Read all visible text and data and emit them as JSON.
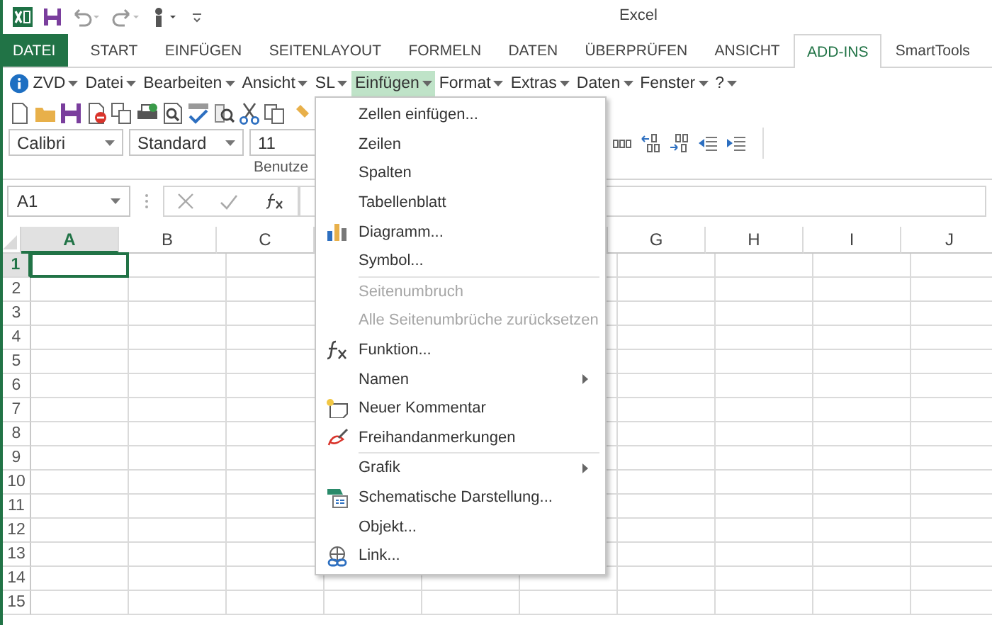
{
  "window": {
    "title": "Excel"
  },
  "ribbon_tabs": [
    {
      "label": "DATEI",
      "selected": false,
      "kind": "file"
    },
    {
      "label": "START",
      "selected": false,
      "kind": "tab"
    },
    {
      "label": "EINFÜGEN",
      "selected": false,
      "kind": "tab"
    },
    {
      "label": "SEITENLAYOUT",
      "selected": false,
      "kind": "tab"
    },
    {
      "label": "FORMELN",
      "selected": false,
      "kind": "tab"
    },
    {
      "label": "DATEN",
      "selected": false,
      "kind": "tab"
    },
    {
      "label": "ÜBERPRÜFEN",
      "selected": false,
      "kind": "tab"
    },
    {
      "label": "ANSICHT",
      "selected": false,
      "kind": "tab"
    },
    {
      "label": "ADD-INS",
      "selected": true,
      "kind": "tab"
    },
    {
      "label": "SmartTools",
      "selected": false,
      "kind": "tab"
    }
  ],
  "menu_bar": [
    {
      "label": "ZVD",
      "selected": false
    },
    {
      "label": "Datei",
      "selected": false
    },
    {
      "label": "Bearbeiten",
      "selected": false
    },
    {
      "label": "Ansicht",
      "selected": false
    },
    {
      "label": "SL",
      "selected": false
    },
    {
      "label": "Einfügen",
      "selected": true
    },
    {
      "label": "Format",
      "selected": false
    },
    {
      "label": "Extras",
      "selected": false
    },
    {
      "label": "Daten",
      "selected": false
    },
    {
      "label": "Fenster",
      "selected": false
    },
    {
      "label": "?",
      "selected": false
    }
  ],
  "font_row": {
    "font": "Calibri",
    "style": "Standard",
    "size": "11"
  },
  "group_label": "Benutze",
  "formula_bar": {
    "name_box": "A1"
  },
  "sheet": {
    "columns": [
      {
        "label": "A",
        "selected": true
      },
      {
        "label": "B",
        "selected": false
      },
      {
        "label": "C",
        "selected": false
      },
      {
        "label": "G",
        "selected": false
      },
      {
        "label": "H",
        "selected": false
      },
      {
        "label": "I",
        "selected": false
      },
      {
        "label": "J",
        "selected": false
      }
    ],
    "rows": [
      {
        "label": "1",
        "selected": true
      },
      {
        "label": "2",
        "selected": false
      },
      {
        "label": "3",
        "selected": false
      },
      {
        "label": "4",
        "selected": false
      },
      {
        "label": "5",
        "selected": false
      },
      {
        "label": "6",
        "selected": false
      },
      {
        "label": "7",
        "selected": false
      },
      {
        "label": "8",
        "selected": false
      },
      {
        "label": "9",
        "selected": false
      },
      {
        "label": "10",
        "selected": false
      },
      {
        "label": "11",
        "selected": false
      },
      {
        "label": "12",
        "selected": false
      },
      {
        "label": "13",
        "selected": false
      },
      {
        "label": "14",
        "selected": false
      },
      {
        "label": "15",
        "selected": false
      }
    ]
  },
  "dropdown_menu": [
    {
      "label": "Zellen einfügen...",
      "kind": "plain",
      "disabled": false,
      "submenu": false,
      "divider_above": false
    },
    {
      "label": "Zeilen",
      "kind": "plain",
      "disabled": false,
      "submenu": false,
      "divider_above": false
    },
    {
      "label": "Spalten",
      "kind": "plain",
      "disabled": false,
      "submenu": false,
      "divider_above": false
    },
    {
      "label": "Tabellenblatt",
      "kind": "plain",
      "disabled": false,
      "submenu": false,
      "divider_above": false
    },
    {
      "label": "Diagramm...",
      "kind": "chart",
      "disabled": false,
      "submenu": false,
      "divider_above": false
    },
    {
      "label": "Symbol...",
      "kind": "plain",
      "disabled": false,
      "submenu": false,
      "divider_above": false
    },
    {
      "label": "Seitenumbruch",
      "kind": "plain",
      "disabled": true,
      "submenu": false,
      "divider_above": true
    },
    {
      "label": "Alle Seitenumbrüche zurücksetzen",
      "kind": "plain",
      "disabled": true,
      "submenu": false,
      "divider_above": false
    },
    {
      "label": "Funktion...",
      "kind": "function",
      "disabled": false,
      "submenu": false,
      "divider_above": false
    },
    {
      "label": "Namen",
      "kind": "plain",
      "disabled": false,
      "submenu": true,
      "divider_above": false
    },
    {
      "label": "Neuer Kommentar",
      "kind": "comment",
      "disabled": false,
      "submenu": false,
      "divider_above": false
    },
    {
      "label": "Freihandanmerkungen",
      "kind": "ink",
      "disabled": false,
      "submenu": false,
      "divider_above": false
    },
    {
      "label": "Grafik",
      "kind": "plain",
      "disabled": false,
      "submenu": true,
      "divider_above": true
    },
    {
      "label": "Schematische Darstellung...",
      "kind": "diagram",
      "disabled": false,
      "submenu": false,
      "divider_above": false
    },
    {
      "label": "Objekt...",
      "kind": "plain",
      "disabled": false,
      "submenu": false,
      "divider_above": false
    },
    {
      "label": "Link...",
      "kind": "link",
      "disabled": false,
      "submenu": false,
      "divider_above": false
    }
  ]
}
